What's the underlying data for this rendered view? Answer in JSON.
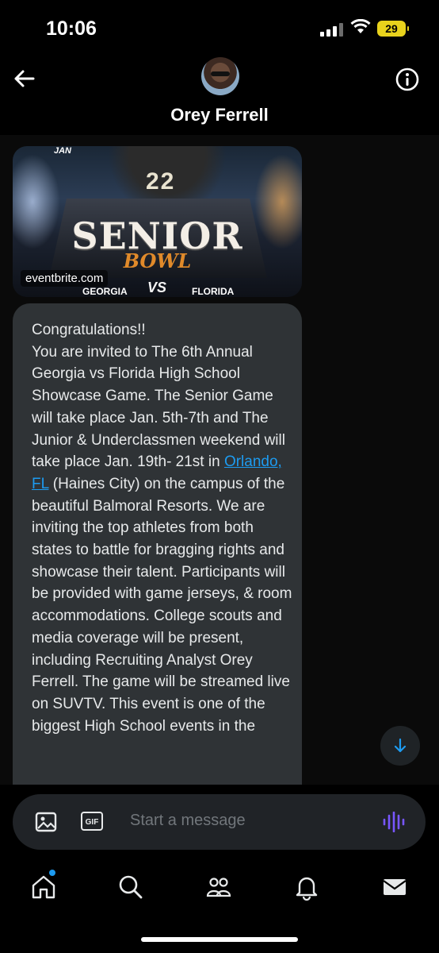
{
  "status_bar": {
    "time": "10:06",
    "battery": "29"
  },
  "header": {
    "contact_name": "Orey Ferrell"
  },
  "link_card": {
    "source": "eventbrite.com",
    "image_text": {
      "jan": "JAN",
      "jersey_number": "22",
      "title": "SENIOR",
      "subtitle": "BOWL",
      "team_left": "GEORGIA",
      "versus": "VS",
      "team_right": "FLORIDA"
    }
  },
  "message": {
    "text_before_link": "Congratulations!!\nYou are invited to The 6th Annual Georgia vs Florida High School Showcase Game. The Senior Game will take place Jan. 5th-7th and The Junior & Underclassmen weekend will take place Jan. 19th- 21st in ",
    "link_text": "Orlando, FL",
    "text_after_link": " (Haines City) on the campus of the beautiful Balmoral Resorts. We are inviting the top athletes from both states to battle for bragging rights and showcase their talent. Participants will be provided with game jerseys, & room accommodations. College scouts and media coverage will be present, including Recruiting Analyst Orey Ferrell. The game will be streamed live on SUVTV. This event is one of the biggest High School events in the"
  },
  "composer": {
    "gif_label": "GIF",
    "placeholder": "Start a message"
  },
  "nav": {
    "items": [
      "home-icon",
      "search-icon",
      "communities-icon",
      "notifications-icon",
      "messages-icon"
    ]
  },
  "colors": {
    "accent": "#1d9bf0",
    "bubble": "#2f3336",
    "voice": "#7856ff"
  }
}
